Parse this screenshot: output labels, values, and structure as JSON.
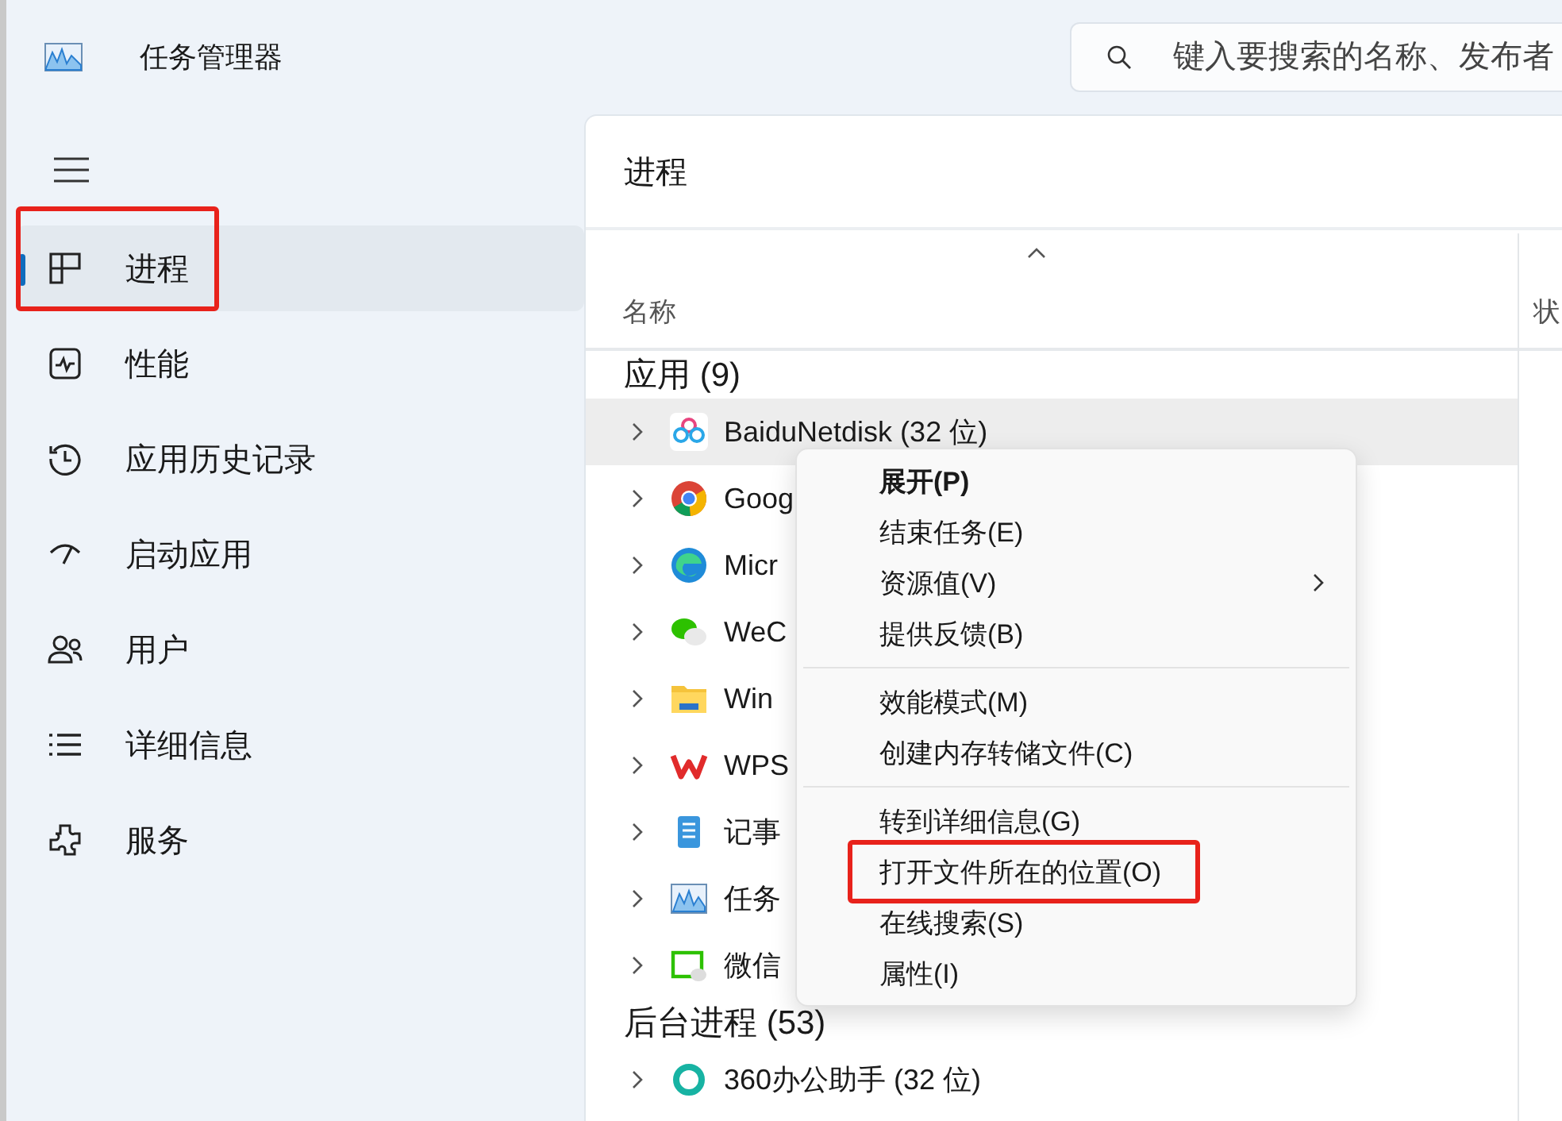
{
  "window": {
    "title": "任务管理器"
  },
  "search": {
    "placeholder": "键入要搜索的名称、发布者"
  },
  "sidebar": {
    "items": [
      {
        "label": "进程",
        "kind": "processes",
        "selected": true,
        "annotated": true
      },
      {
        "label": "性能",
        "kind": "performance",
        "selected": false,
        "annotated": false
      },
      {
        "label": "应用历史记录",
        "kind": "history",
        "selected": false,
        "annotated": false
      },
      {
        "label": "启动应用",
        "kind": "startup",
        "selected": false,
        "annotated": false
      },
      {
        "label": "用户",
        "kind": "users",
        "selected": false,
        "annotated": false
      },
      {
        "label": "详细信息",
        "kind": "details",
        "selected": false,
        "annotated": false
      },
      {
        "label": "服务",
        "kind": "services",
        "selected": false,
        "annotated": false
      }
    ]
  },
  "panel": {
    "title": "进程",
    "columns": [
      "名称",
      "状"
    ],
    "groups": [
      {
        "label": "应用 (9)",
        "rows": [
          {
            "name": "BaiduNetdisk (32 位)",
            "kind": "cloud",
            "hovered": true
          },
          {
            "name": "Goog",
            "kind": "chrome",
            "hovered": false
          },
          {
            "name": "Micr",
            "kind": "edge",
            "hovered": false
          },
          {
            "name": "WeC",
            "kind": "chat",
            "hovered": false
          },
          {
            "name": "Win",
            "kind": "folder",
            "hovered": false
          },
          {
            "name": "WPS",
            "kind": "wps",
            "hovered": false
          },
          {
            "name": "记事",
            "kind": "notepad",
            "hovered": false
          },
          {
            "name": "任务",
            "kind": "monitor",
            "hovered": false
          },
          {
            "name": "微信",
            "kind": "chatwindow",
            "hovered": false
          }
        ]
      },
      {
        "label": "后台进程 (53)",
        "rows": [
          {
            "name": "360办公助手 (32 位)",
            "kind": "ring",
            "hovered": false
          }
        ]
      }
    ]
  },
  "context_menu": {
    "sections": [
      [
        {
          "label": "展开(P)",
          "default": true,
          "submenu": false,
          "annotated": false
        },
        {
          "label": "结束任务(E)",
          "default": false,
          "submenu": false,
          "annotated": false
        },
        {
          "label": "资源值(V)",
          "default": false,
          "submenu": true,
          "annotated": false
        },
        {
          "label": "提供反馈(B)",
          "default": false,
          "submenu": false,
          "annotated": false
        }
      ],
      [
        {
          "label": "效能模式(M)",
          "default": false,
          "submenu": false,
          "annotated": false
        },
        {
          "label": "创建内存转储文件(C)",
          "default": false,
          "submenu": false,
          "annotated": false
        }
      ],
      [
        {
          "label": "转到详细信息(G)",
          "default": false,
          "submenu": false,
          "annotated": false
        },
        {
          "label": "打开文件所在的位置(O)",
          "default": false,
          "submenu": false,
          "annotated": true
        },
        {
          "label": "在线搜索(S)",
          "default": false,
          "submenu": false,
          "annotated": false
        },
        {
          "label": "属性(I)",
          "default": false,
          "submenu": false,
          "annotated": false
        }
      ]
    ]
  }
}
